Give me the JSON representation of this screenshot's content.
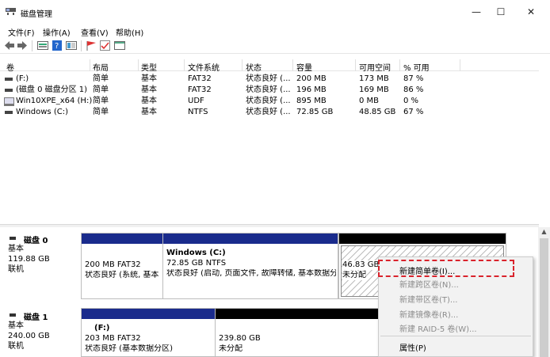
{
  "window": {
    "title": "磁盘管理",
    "minimize": "—",
    "maximize": "☐",
    "close": "✕"
  },
  "menu": [
    "文件(F)",
    "操作(A)",
    "查看(V)",
    "帮助(H)"
  ],
  "toolbar_icons": [
    "back-icon",
    "forward-icon",
    "disk-list-icon",
    "help-icon",
    "properties-icon",
    "flag-icon",
    "check-icon",
    "console-icon"
  ],
  "volume_table": {
    "headers": [
      "卷",
      "布局",
      "类型",
      "文件系统",
      "状态",
      "容量",
      "可用空间",
      "% 可用"
    ],
    "rows": [
      [
        "(F:)",
        "简单",
        "基本",
        "FAT32",
        "状态良好 (...",
        "200 MB",
        "173 MB",
        "87 %"
      ],
      [
        "(磁盘 0 磁盘分区 1)",
        "简单",
        "基本",
        "FAT32",
        "状态良好 (...",
        "196 MB",
        "169 MB",
        "86 %"
      ],
      [
        "Win10XPE_x64 (H:)",
        "简单",
        "基本",
        "UDF",
        "状态良好 (...",
        "895 MB",
        "0 MB",
        "0 %"
      ],
      [
        "Windows (C:)",
        "简单",
        "基本",
        "NTFS",
        "状态良好 (...",
        "72.85 GB",
        "48.85 GB",
        "67 %"
      ]
    ]
  },
  "disks": [
    {
      "name": "磁盘 0",
      "type": "基本",
      "size": "119.88 GB",
      "status": "联机",
      "partitions": [
        {
          "line1": "",
          "line2": "200 MB FAT32",
          "line3": "状态良好 (系统, 基本"
        },
        {
          "line1": "Windows (C:)",
          "line2": "72.85 GB NTFS",
          "line3": "状态良好 (启动, 页面文件, 故障转储, 基本数据分"
        },
        {
          "line1": "",
          "line2": "46.83 GB",
          "line3": "未分配"
        }
      ]
    },
    {
      "name": "磁盘 1",
      "type": "基本",
      "size": "240.00 GB",
      "status": "联机",
      "partitions": [
        {
          "line1": "(F:)",
          "line2": "203 MB FAT32",
          "line3": "状态良好 (基本数据分区)"
        },
        {
          "line1": "",
          "line2": "239.80 GB",
          "line3": "未分配"
        }
      ]
    }
  ],
  "context_menu": {
    "items": [
      {
        "label": "新建简单卷(I)...",
        "enabled": true
      },
      {
        "label": "新建跨区卷(N)...",
        "enabled": false
      },
      {
        "label": "新建带区卷(T)...",
        "enabled": false
      },
      {
        "label": "新建镜像卷(R)...",
        "enabled": false
      },
      {
        "label": "新建 RAID-5 卷(W)...",
        "enabled": false
      },
      {
        "label": "属性(P)",
        "enabled": true
      }
    ]
  },
  "colors": {
    "primary_partition": "#1a2b8c",
    "unallocated": "#000000",
    "highlight": "#d9232c"
  }
}
